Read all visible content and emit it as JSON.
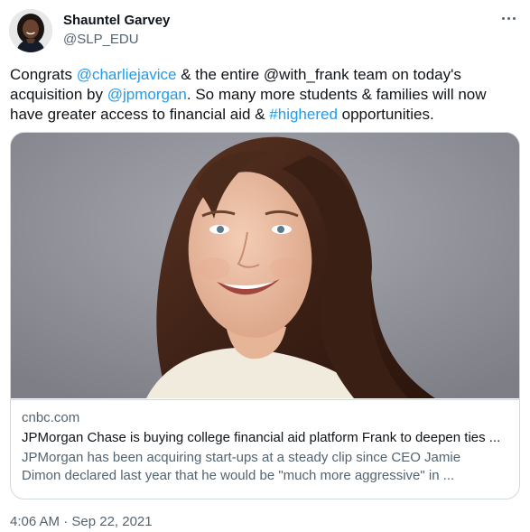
{
  "author": {
    "display_name": "Shauntel Garvey",
    "handle": "@SLP_EDU"
  },
  "more_icon": "more-horizontal-icon",
  "tweet": {
    "segments": [
      {
        "text": "Congrats ",
        "type": "text"
      },
      {
        "text": "@charliejavice",
        "type": "link"
      },
      {
        "text": " & the entire @with_frank team on today's acquisition by ",
        "type": "text"
      },
      {
        "text": "@jpmorgan",
        "type": "link"
      },
      {
        "text": ". So many more students & families will now have greater access to financial aid & ",
        "type": "text"
      },
      {
        "text": "#highered",
        "type": "link"
      },
      {
        "text": " opportunities.",
        "type": "text"
      }
    ]
  },
  "card": {
    "domain": "cnbc.com",
    "title": "JPMorgan Chase is buying college financial aid platform Frank to deepen ties ...",
    "description_line1": "JPMorgan has been acquiring start-ups at a steady clip since CEO Jamie",
    "description_line2": "Dimon declared last year that he would be \"much more aggressive\" in ..."
  },
  "timestamp": "4:06 AM · Sep 22, 2021",
  "colors": {
    "link": "#1d9bf0",
    "text": "#0f1419",
    "secondary": "#536471",
    "border": "#cfd9de"
  }
}
